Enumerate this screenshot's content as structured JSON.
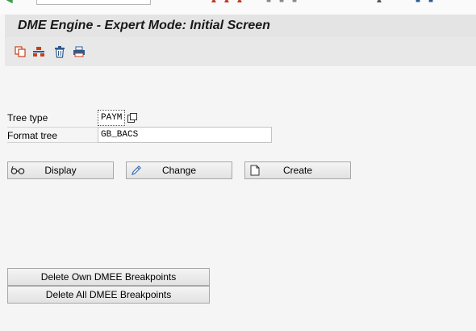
{
  "screen": {
    "title": "DME Engine - Expert Mode: Initial Screen"
  },
  "toolbar": {
    "icons": [
      "copy-icon",
      "transport-icon",
      "delete-icon",
      "print-icon"
    ]
  },
  "form": {
    "tree_type": {
      "label": "Tree type",
      "value": "PAYM"
    },
    "format_tree": {
      "label": "Format tree",
      "value": "GB_BACS"
    }
  },
  "buttons": {
    "display": "Display",
    "change": "Change",
    "create": "Create",
    "delete_own_breakpoints": "Delete Own DMEE Breakpoints",
    "delete_all_breakpoints": "Delete All DMEE Breakpoints"
  },
  "colors": {
    "toolbar_icon_red": "#c8401a",
    "toolbar_icon_blue": "#2c5a8f",
    "change_icon_blue": "#3a6db5"
  }
}
